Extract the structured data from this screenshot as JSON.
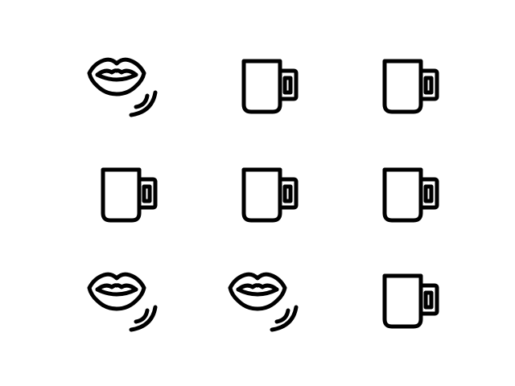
{
  "grid": {
    "rows": 3,
    "cols": 3,
    "stroke_color": "#000000",
    "background_color": "#ffffff",
    "icons": [
      "speaking-lips-icon",
      "coffee-mug-icon",
      "coffee-mug-icon",
      "coffee-mug-icon",
      "coffee-mug-icon",
      "coffee-mug-icon",
      "speaking-lips-icon",
      "speaking-lips-icon",
      "coffee-mug-icon"
    ]
  }
}
